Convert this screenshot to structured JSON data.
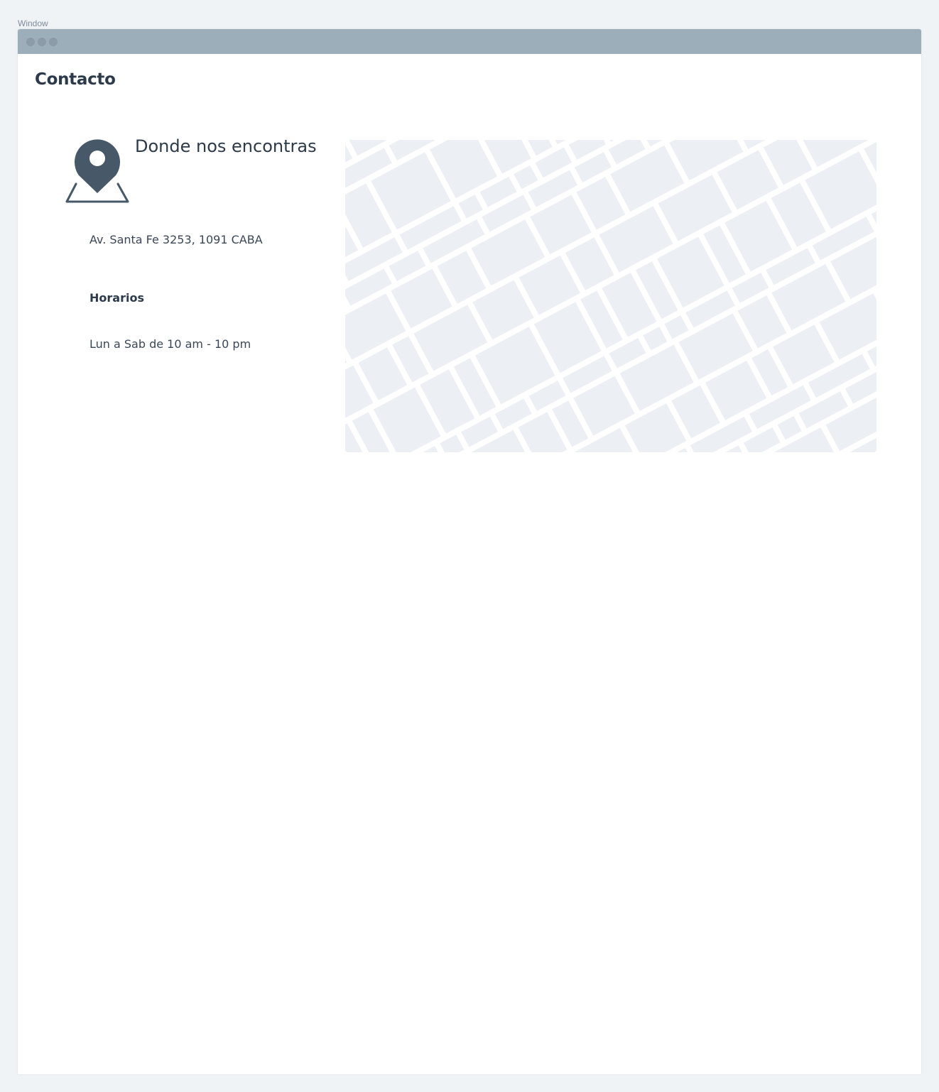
{
  "window": {
    "label": "Window"
  },
  "page": {
    "title": "Contacto"
  },
  "location": {
    "icon": "map-pin-icon",
    "title": "Donde nos encontras",
    "address": "Av. Santa Fe 3253, 1091 CABA",
    "hours_title": "Horarios",
    "hours_value": "Lun a Sab de 10 am - 10 pm"
  },
  "map": {
    "icon": "map-placeholder"
  },
  "colors": {
    "background": "#eff3f6",
    "titlebar": "#9daebb",
    "text": "#2c3a4a",
    "icon": "#475869",
    "map_block": "#eceff4"
  }
}
